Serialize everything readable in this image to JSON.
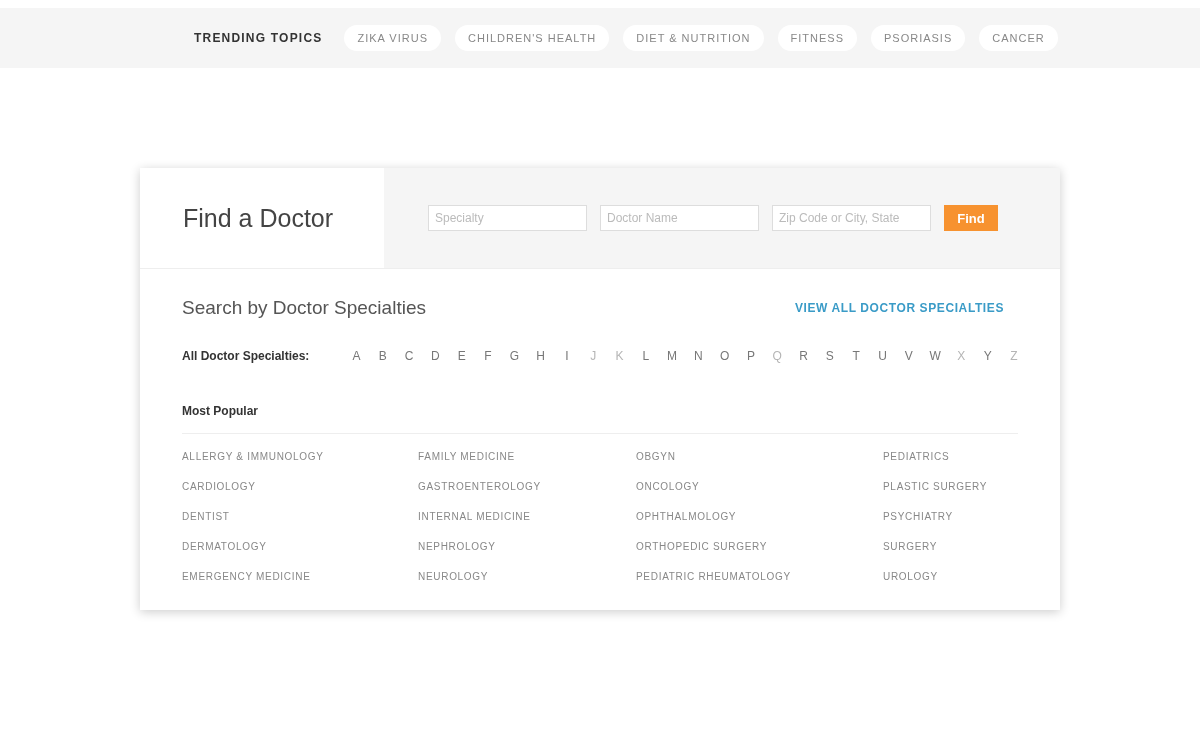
{
  "trending": {
    "label": "TRENDING TOPICS",
    "topics": [
      "ZIKA VIRUS",
      "CHILDREN'S HEALTH",
      "DIET & NUTRITION",
      "FITNESS",
      "PSORIASIS",
      "CANCER"
    ]
  },
  "finder": {
    "title": "Find a Doctor",
    "fields": [
      {
        "placeholder": "Specialty"
      },
      {
        "placeholder": "Doctor Name"
      },
      {
        "placeholder": "Zip Code or City, State"
      }
    ],
    "button": "Find"
  },
  "specialties": {
    "heading": "Search by Doctor Specialties",
    "view_all": "VIEW ALL DOCTOR SPECIALTIES",
    "alphabet_label": "All Doctor Specialties:",
    "letters": [
      {
        "letter": "A",
        "disabled": false
      },
      {
        "letter": "B",
        "disabled": false
      },
      {
        "letter": "C",
        "disabled": false
      },
      {
        "letter": "D",
        "disabled": false
      },
      {
        "letter": "E",
        "disabled": false
      },
      {
        "letter": "F",
        "disabled": false
      },
      {
        "letter": "G",
        "disabled": false
      },
      {
        "letter": "H",
        "disabled": false
      },
      {
        "letter": "I",
        "disabled": false
      },
      {
        "letter": "J",
        "disabled": true
      },
      {
        "letter": "K",
        "disabled": true
      },
      {
        "letter": "L",
        "disabled": false
      },
      {
        "letter": "M",
        "disabled": false
      },
      {
        "letter": "N",
        "disabled": false
      },
      {
        "letter": "O",
        "disabled": false
      },
      {
        "letter": "P",
        "disabled": false
      },
      {
        "letter": "Q",
        "disabled": true
      },
      {
        "letter": "R",
        "disabled": false
      },
      {
        "letter": "S",
        "disabled": false
      },
      {
        "letter": "T",
        "disabled": false
      },
      {
        "letter": "U",
        "disabled": false
      },
      {
        "letter": "V",
        "disabled": false
      },
      {
        "letter": "W",
        "disabled": false
      },
      {
        "letter": "X",
        "disabled": true
      },
      {
        "letter": "Y",
        "disabled": false
      },
      {
        "letter": "Z",
        "disabled": true
      }
    ],
    "popular_label": "Most Popular",
    "columns": [
      [
        "ALLERGY & IMMUNOLOGY",
        "CARDIOLOGY",
        "DENTIST",
        "DERMATOLOGY",
        "EMERGENCY MEDICINE"
      ],
      [
        "FAMILY MEDICINE",
        "GASTROENTEROLOGY",
        "INTERNAL MEDICINE",
        "NEPHROLOGY",
        "NEUROLOGY"
      ],
      [
        "OBGYN",
        "ONCOLOGY",
        "OPHTHALMOLOGY",
        "ORTHOPEDIC SURGERY",
        "PEDIATRIC RHEUMATOLOGY"
      ],
      [
        "PEDIATRICS",
        "PLASTIC SURGERY",
        "PSYCHIATRY",
        "SURGERY",
        "UROLOGY"
      ]
    ]
  }
}
